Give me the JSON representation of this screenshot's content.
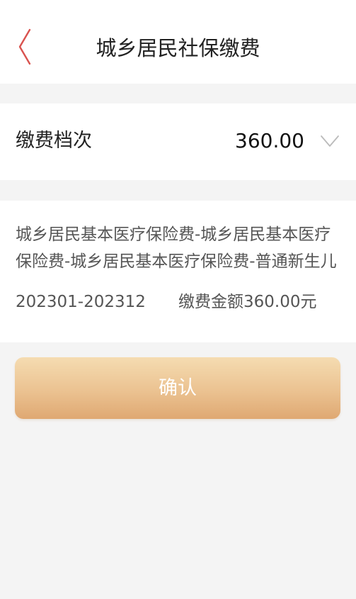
{
  "header": {
    "title": "城乡居民社保缴费",
    "back_icon": "chevron-left-icon",
    "back_icon_color": "#d9534f"
  },
  "payment_tier": {
    "label": "缴费档次",
    "value": "360.00",
    "dropdown_icon": "chevron-down-icon"
  },
  "description": {
    "text": "城乡居民基本医疗保险费-城乡居民基本医疗保险费-城乡居民基本医疗保险费-普通新生儿",
    "period": "202301-202312",
    "amount": "缴费金额360.00元"
  },
  "confirm": {
    "label": "确认"
  },
  "colors": {
    "background": "#f4f4f4",
    "card": "#ffffff",
    "button_gradient_top": "#f5dcb1",
    "button_gradient_bottom": "#dfa872"
  }
}
